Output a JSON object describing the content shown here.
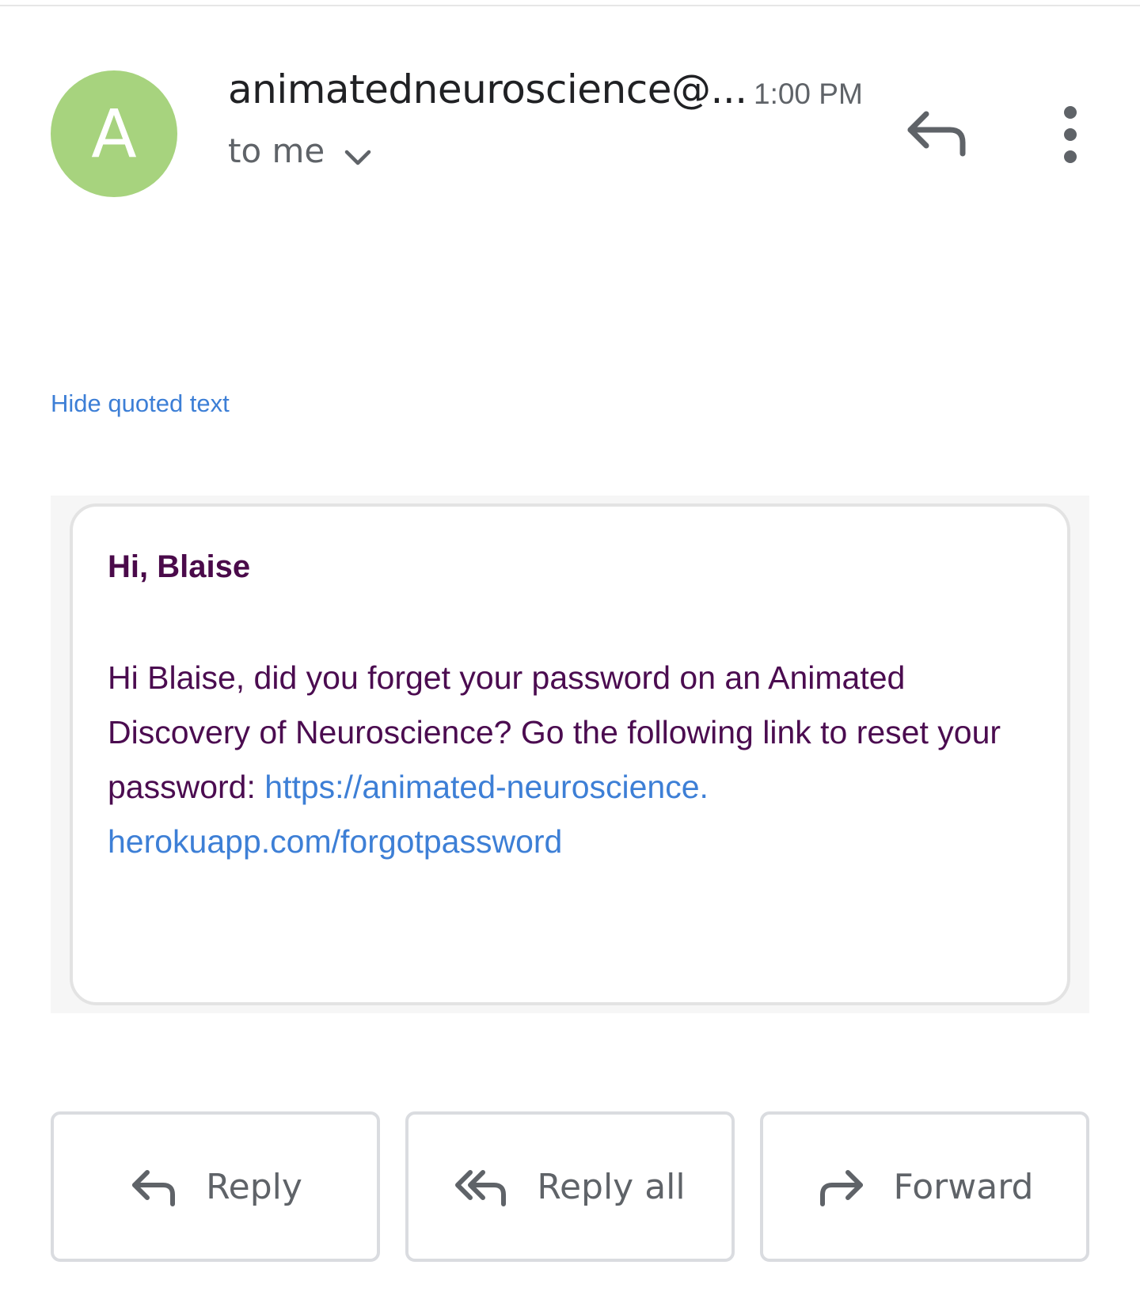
{
  "header": {
    "avatar_letter": "A",
    "avatar_color": "#a7d37e",
    "sender": "animatedneuroscience@...",
    "time": "1:00 PM",
    "recipient": "to me",
    "icons": [
      "chevron-down-icon",
      "reply-icon",
      "more-vert-icon"
    ]
  },
  "message": {
    "hide_quoted_label": "Hide quoted text",
    "greeting": "Hi, Blaise",
    "body_prefix": "Hi Blaise, did you forget your password on an Animated Discovery of Neuroscience? Go the following link to reset your password: ",
    "link_line1": "https://animated-neuroscience.",
    "link_line2": "herokuapp.com/forgotpassword",
    "text_color": "#4b0c50",
    "link_color": "#3d7fd6"
  },
  "actions": {
    "reply_label": "Reply",
    "reply_all_label": "Reply all",
    "forward_label": "Forward",
    "icons": [
      "reply-icon",
      "reply-all-icon",
      "forward-icon"
    ]
  }
}
